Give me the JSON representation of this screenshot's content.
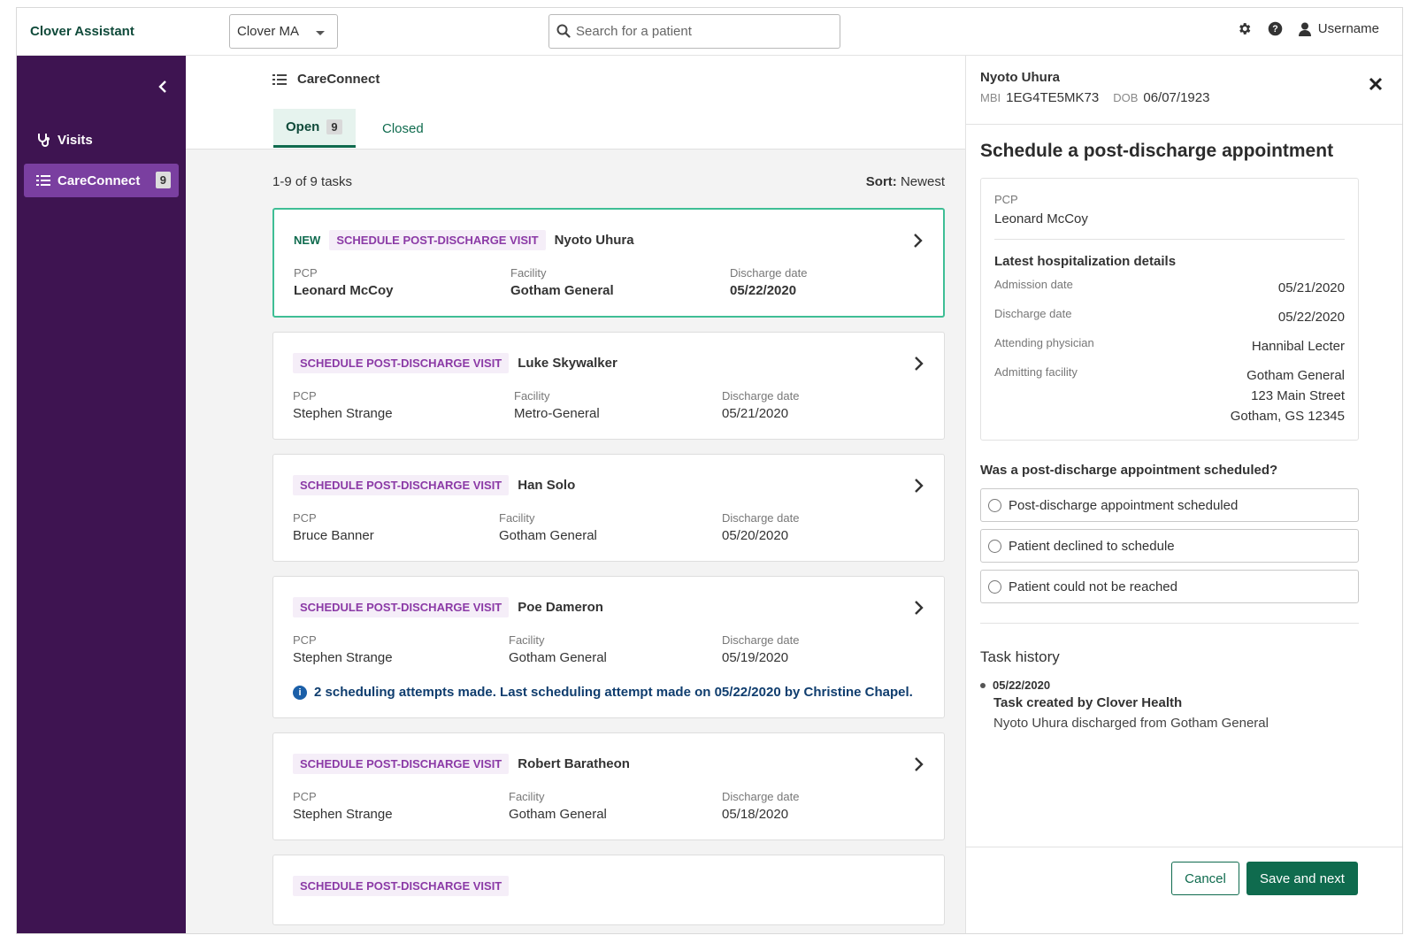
{
  "app": {
    "brand": "Clover Assistant"
  },
  "topbar": {
    "org_select": "Clover MA",
    "search_placeholder": "Search for a patient",
    "username": "Username",
    "icons": [
      "gear-icon",
      "help-icon",
      "user-icon"
    ]
  },
  "sidebar": {
    "items": [
      {
        "label": "Visits",
        "icon": "stethoscope-icon"
      },
      {
        "label": "CareConnect",
        "icon": "checklist-icon",
        "badge": "9",
        "active": true
      }
    ]
  },
  "main": {
    "section_title": "CareConnect",
    "tabs": [
      {
        "label": "Open",
        "badge": "9",
        "active": true
      },
      {
        "label": "Closed"
      }
    ],
    "count_text": "1-9 of 9 tasks",
    "sort_label": "Sort:",
    "sort_value": "Newest",
    "field_labels": {
      "pcp": "PCP",
      "facility": "Facility",
      "discharge": "Discharge date"
    },
    "tasks": [
      {
        "new_label": "NEW",
        "type": "Schedule post-discharge visit",
        "patient": "Nyoto Uhura",
        "pcp": "Leonard McCoy",
        "facility": "Gotham General",
        "discharge_date": "05/22/2020"
      },
      {
        "type": "Schedule post-discharge visit",
        "patient": "Luke Skywalker",
        "pcp": "Stephen Strange",
        "facility": "Metro-General",
        "discharge_date": "05/21/2020"
      },
      {
        "type": "Schedule post-discharge visit",
        "patient": "Han Solo",
        "pcp": "Bruce Banner",
        "facility": "Gotham General",
        "discharge_date": "05/20/2020"
      },
      {
        "type": "Schedule post-discharge visit",
        "patient": "Poe Dameron",
        "pcp": "Stephen Strange",
        "facility": "Gotham General",
        "discharge_date": "05/19/2020",
        "note": "2 scheduling attempts made. Last scheduling attempt made on 05/22/2020 by Christine Chapel."
      },
      {
        "type": "Schedule post-discharge visit",
        "patient": "Robert Baratheon",
        "pcp": "Stephen Strange",
        "facility": "Gotham General",
        "discharge_date": "05/18/2020"
      },
      {
        "type": "Schedule post-discharge visit"
      }
    ]
  },
  "panel": {
    "patient_name": "Nyoto Uhura",
    "mbi_label": "MBI",
    "mbi": "1EG4TE5MK73",
    "dob_label": "DOB",
    "dob": "06/07/1923",
    "title": "Schedule a post-discharge appointment",
    "pcp_label": "PCP",
    "pcp": "Leonard McCoy",
    "hosp_title": "Latest hospitalization details",
    "admission_label": "Admission date",
    "admission": "05/21/2020",
    "discharge_label": "Discharge date",
    "discharge": "05/22/2020",
    "physician_label": "Attending physician",
    "physician": "Hannibal Lecter",
    "facility_label": "Admitting facility",
    "facility_line1": "Gotham General",
    "facility_line2": "123 Main Street",
    "facility_line3": "Gotham, GS 12345",
    "question": "Was a post-discharge appointment scheduled?",
    "options": [
      "Post-discharge appointment scheduled",
      "Patient declined to schedule",
      "Patient could not be reached"
    ],
    "history_title": "Task history",
    "history": [
      {
        "date": "05/22/2020",
        "line1": "Task created by Clover Health",
        "line2": "Nyoto Uhura discharged from Gotham General"
      }
    ],
    "cancel_label": "Cancel",
    "save_label": "Save and next"
  }
}
